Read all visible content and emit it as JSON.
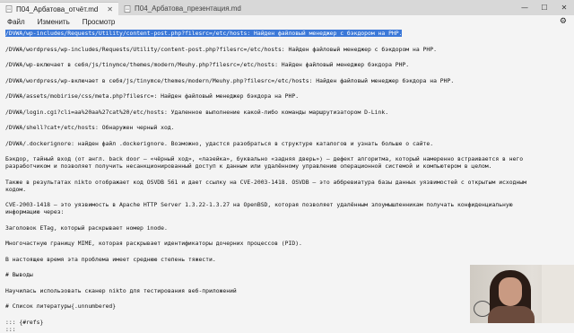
{
  "tabs": [
    {
      "label": "П04_Арбатова_отчёт.md"
    },
    {
      "label": "П04_Арбатова_презентация.md"
    }
  ],
  "window_controls": {
    "minimize": "—",
    "maximize": "☐",
    "close": "✕"
  },
  "menu": {
    "file": "Файл",
    "edit": "Изменить",
    "view": "Просмотр"
  },
  "editor": {
    "lines": [
      "/DVWA/wp-includes/Requests/Utility/content-post.php?filesrc=/etc/hosts: Найден файловый менеджер с бэкдором на PHP.",
      "/DVWA/wordpress/wp-includes/Requests/Utility/content-post.php?filesrc=/etc/hosts: Найден файловый менеджер с бэкдором на PHP.",
      "/DVWA/wp-включает в себя/js/tinymce/themes/modern/Meuhy.php?filesrc=/etc/hosts: Найден файловый менеджер бэкдора PHP.",
      "/DVWA/wordpress/wp-включает в себя/js/tinymce/themes/modern/Meuhy.php?filesrc=/etc/hosts: Найден файловый менеджер бэкдора на PHP.",
      "/DVWA/assets/mobirise/css/meta.php?filesrc=: Найден файловый менеджер бэкдора на PHP.",
      "/DVWA/login.cgi?cli=aa%20aa%27cat%20/etc/hosts: Удаленное выполнение какой-либо команды маршрутизатором D-Link.",
      "/DVWA/shell?cat+/etc/hosts: Обнаружен черный ход.",
      "/DVWA/.dockerignore: найден файл .dockerignore. Возможно, удастся разобраться в структуре каталогов и узнать больше о сайте."
    ],
    "paragraph_backdoor_1": "Бэкдор, тайный вход (от англ. back door — «чёрный ход», «лазейка», буквально «задняя дверь») — дефект алгоритма, который намеренно встраивается в него",
    "paragraph_backdoor_2": "разработчиком и позволяет получить несанкционированный доступ к данным или удалённому управлению операционной системой и компьютером в целом.",
    "paragraph_osvdb_1": "Также в результатах nikto отображает код OSVDB 561 и дает ссылку на CVE-2003-1418. OSVDB — это аббревиатура базы данных уязвимостей с открытым исходным",
    "paragraph_osvdb_2": "кодом.",
    "paragraph_cve_1": "CVE-2003-1418 — это уязвимость в Apache HTTP Server 1.3.22-1.3.27 на OpenBSD, которая позволяет удалённым злоумышленникам получать конфиденциальную",
    "paragraph_cve_2": "информацию через:",
    "paragraph_etag": "Заголовок ETag, который раскрывает номер inode.",
    "paragraph_mime": "Многочастную границу MIME, которая раскрывает идентификаторы дочерних процессов (PID).",
    "paragraph_severity": "В настоящее время эта проблема имеет среднюю степень тяжести.",
    "heading_conclusions": "# Выводы",
    "paragraph_learned": "Научилась использовать сканер nikto для тестирования веб-приложений",
    "heading_references": "# Список литературы{.unnumbered}",
    "refs_open": "::: {#refs}",
    "refs_close": ":::"
  }
}
